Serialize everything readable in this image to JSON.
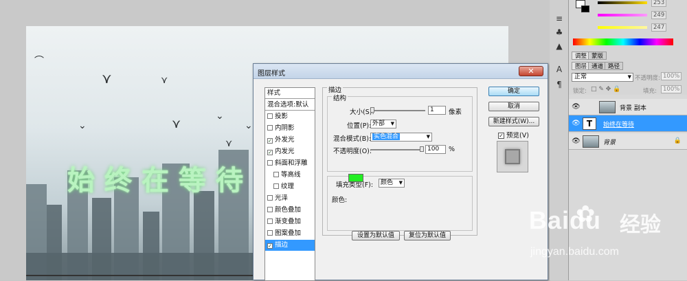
{
  "canvas": {
    "doc_text": "始终在等待"
  },
  "dialog": {
    "title": "图层样式",
    "close_label": "✕",
    "style_list": [
      {
        "label": "样式",
        "checked": null,
        "selected": false,
        "header": true
      },
      {
        "label": "混合选项:默认",
        "checked": null,
        "selected": false,
        "header": true
      },
      {
        "label": "投影",
        "checked": false,
        "selected": false
      },
      {
        "label": "内阴影",
        "checked": false,
        "selected": false
      },
      {
        "label": "外发光",
        "checked": true,
        "selected": false
      },
      {
        "label": "内发光",
        "checked": true,
        "selected": false
      },
      {
        "label": "斜面和浮雕",
        "checked": false,
        "selected": false
      },
      {
        "label": "等高线",
        "checked": false,
        "selected": false,
        "indent": true
      },
      {
        "label": "纹理",
        "checked": false,
        "selected": false,
        "indent": true
      },
      {
        "label": "光泽",
        "checked": false,
        "selected": false
      },
      {
        "label": "颜色叠加",
        "checked": false,
        "selected": false
      },
      {
        "label": "渐变叠加",
        "checked": false,
        "selected": false
      },
      {
        "label": "图案叠加",
        "checked": false,
        "selected": false
      },
      {
        "label": "描边",
        "checked": true,
        "selected": true
      }
    ],
    "stroke": {
      "section_title": "描边",
      "structure_title": "结构",
      "size_label": "大小(S):",
      "size_value": "1",
      "size_unit": "像素",
      "position_label": "位置(P):",
      "position_value": "外部",
      "blend_label": "混合模式(B):",
      "blend_value": "实色混合",
      "opacity_label": "不透明度(O):",
      "opacity_value": "100",
      "opacity_unit": "%",
      "fill_type_label": "填充类型(F):",
      "fill_type_value": "颜色",
      "color_label": "颜色:",
      "color_hex": "#22ee22",
      "set_default": "设置为默认值",
      "reset_default": "复位为默认值"
    },
    "buttons": {
      "ok": "确定",
      "cancel": "取消",
      "new_style": "新建样式(W)...",
      "preview_label": "预览(V)",
      "preview_checked": true
    }
  },
  "right": {
    "color_values": [
      "253",
      "249",
      "247"
    ],
    "tabs_top": [
      "调整",
      "蒙版"
    ],
    "tabs_layers": [
      "图层",
      "通道",
      "路径"
    ],
    "blend_mode": "正常",
    "opacity_label": "不透明度:",
    "opacity_value": "100%",
    "lock_label": "锁定:",
    "fill_label": "填充:",
    "fill_value": "100%",
    "layers": [
      {
        "name": "背景 副本",
        "type": "image",
        "selected": false
      },
      {
        "name": "始终在等待",
        "type": "text",
        "selected": true
      },
      {
        "name": "背景",
        "type": "image",
        "selected": false,
        "locked": true
      }
    ]
  },
  "watermark": {
    "brand_en": "Baidu",
    "brand_cn": "经验",
    "url": "jingyan.baidu.com"
  }
}
